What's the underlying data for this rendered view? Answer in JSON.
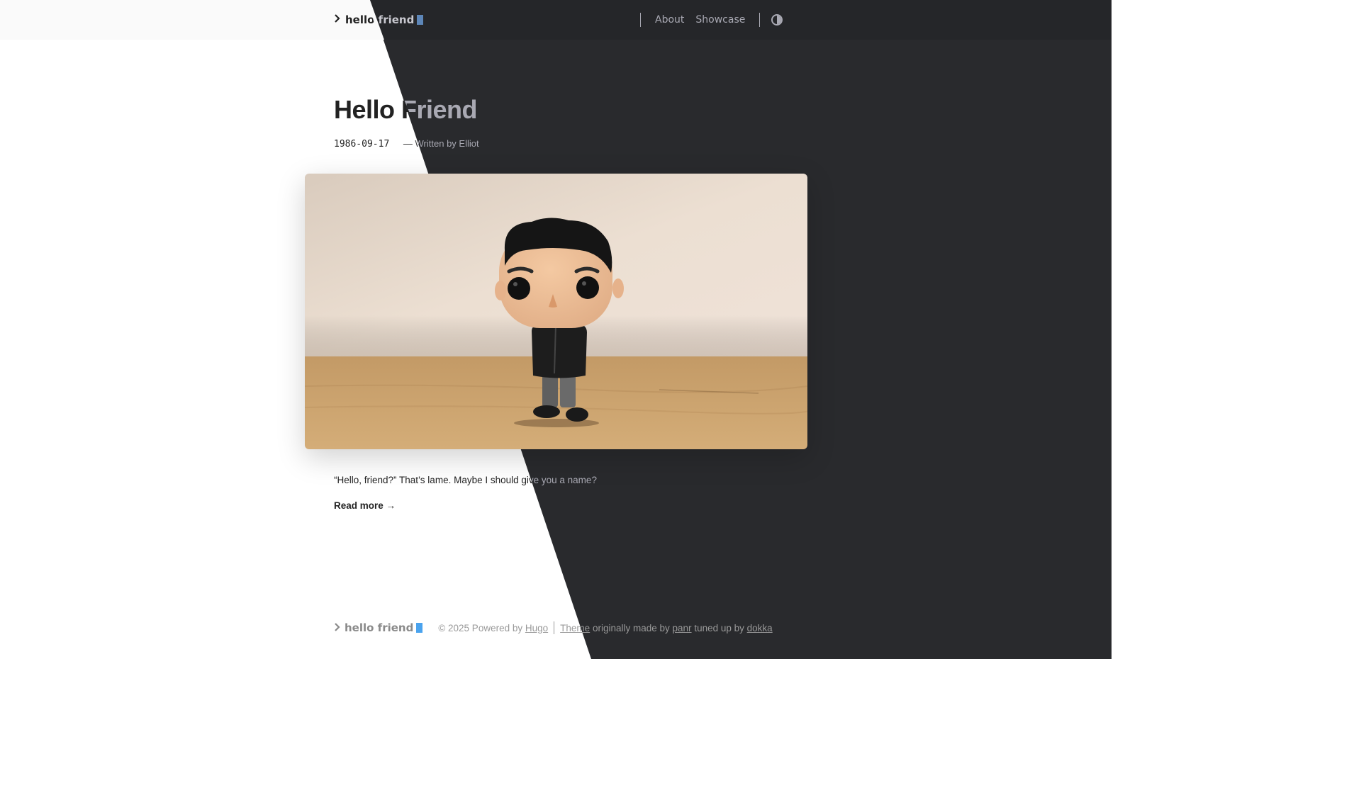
{
  "header": {
    "logo_text": "hello friend",
    "nav": [
      {
        "label": "About"
      },
      {
        "label": "Showcase"
      }
    ]
  },
  "post": {
    "title": "Hello Friend",
    "date": "1986-09-17",
    "author_line": "— Written by Elliot",
    "lead": "“Hello, friend?” That’s lame. Maybe I should give you a name?",
    "read_more": "Read more →"
  },
  "footer": {
    "logo_text": "hello friend",
    "copyright": "© 2025 Powered by",
    "hugo_link": "Hugo",
    "theme_link": "Theme",
    "originally": "originally made by",
    "panr_link": "panr",
    "tuned": "tuned up by",
    "dokka_link": "dokka"
  },
  "icons": {
    "logo_chevron": "chevron-right-icon",
    "theme_toggle": "contrast-icon"
  },
  "colors": {
    "dark_bg": "#292a2d",
    "light_bg": "#ffffff",
    "cursor_blue": "#4aa3ee"
  }
}
